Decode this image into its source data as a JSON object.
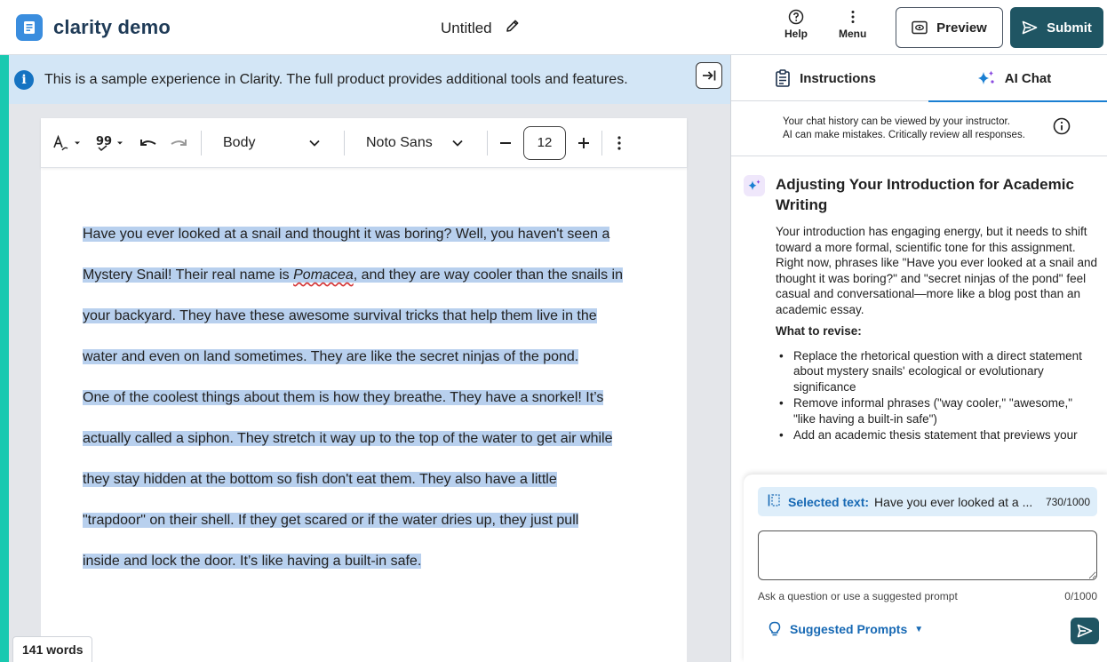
{
  "header": {
    "brand_name": "clarity demo",
    "doc_title": "Untitled",
    "help_label": "Help",
    "menu_label": "Menu",
    "preview_label": "Preview",
    "submit_label": "Submit"
  },
  "banner": {
    "text": "This is a sample experience in Clarity. The full product provides additional tools and features."
  },
  "toolbar": {
    "style_value": "Body",
    "font_value": "Noto Sans",
    "font_size": "12"
  },
  "document": {
    "line_1": "Have you ever looked at a snail and thought it was boring? Well, you haven't seen a",
    "line_2a": "Mystery Snail! Their real name is ",
    "line_2_italic": "Pomacea",
    "line_2b": ", and they are way cooler than the snails in",
    "line_3": "your backyard. They have these awesome survival tricks that help them live in the",
    "line_4": "water and even on land sometimes. They are like the secret ninjas of the pond.",
    "line_5": "One of the coolest things about them is how they breathe. They have a snorkel! It’s",
    "line_6": "actually called a siphon. They stretch it way up to the top of the water to get air while",
    "line_7": "they stay hidden at the bottom so fish don't eat them. They also have a little",
    "line_8": "\"trapdoor\" on their shell. If they get scared or if the water dries up, they just pull",
    "line_9": "inside and lock the door. It’s like having a built-in safe."
  },
  "status": {
    "word_count": "141 words"
  },
  "panel": {
    "tabs": [
      {
        "label": "Instructions"
      },
      {
        "label": "AI Chat"
      }
    ],
    "notice_line_1": "Your chat history can be viewed by your instructor.",
    "notice_line_2": "AI can make mistakes. Critically review all responses.",
    "chat": {
      "heading": "Adjusting Your Introduction for Academic Writing",
      "paragraph": "Your introduction has engaging energy, but it needs to shift toward a more formal, scientific tone for this assignment. Right now, phrases like \"Have you ever looked at a snail and thought it was boring?\" and \"secret ninjas of the pond\" feel casual and conversational—more like a blog post than an academic essay.",
      "revise_label": "What to revise:",
      "bullets": [
        "Replace the rhetorical question with a direct statement about mystery snails' ecological or evolutionary significance",
        "Remove informal phrases (\"way cooler,\" \"awesome,\" \"like having a built-in safe\")",
        "Add an academic thesis statement that previews your"
      ]
    },
    "composer": {
      "selected_label": "Selected text:",
      "selected_value": "Have you ever looked at a ...",
      "selected_count": "730/1000",
      "input_value": "",
      "hint": "Ask a question or use a suggested prompt",
      "hint_count": "0/1000",
      "suggested_label": "Suggested Prompts"
    }
  },
  "colors": {
    "accent_teal": "#1f5563",
    "link_blue": "#1769b4",
    "highlight": "#b8d0ee",
    "banner_bg": "#d3e6f6",
    "outer_bg": "#19c9b0"
  }
}
